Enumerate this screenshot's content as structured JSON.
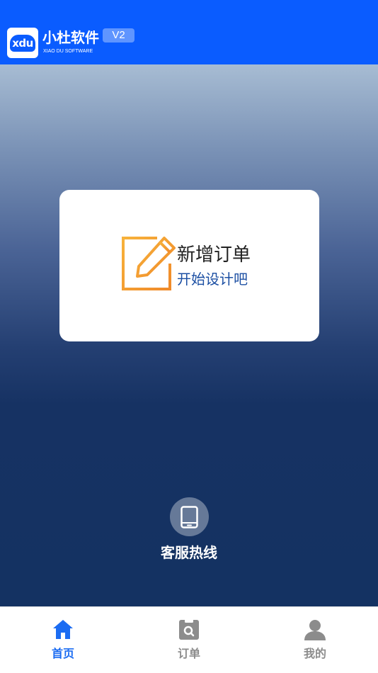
{
  "header": {
    "logo_mark": "xdu",
    "brand_name": "小杜软件",
    "brand_subtitle": "XIAO DU SOFTWARE",
    "version": "V2",
    "color": "#0a5cff"
  },
  "order_card": {
    "icon": "edit-icon",
    "title": "新增订单",
    "subtitle": "开始设计吧"
  },
  "hotline": {
    "icon": "phone-icon",
    "label": "客服热线"
  },
  "tabbar": {
    "active_color": "#1b6cf2",
    "inactive_color": "#8c8c8c",
    "tabs": [
      {
        "label": "首页",
        "icon": "home-icon",
        "active": true
      },
      {
        "label": "订单",
        "icon": "order-icon",
        "active": false
      },
      {
        "label": "我的",
        "icon": "user-icon",
        "active": false
      }
    ]
  }
}
